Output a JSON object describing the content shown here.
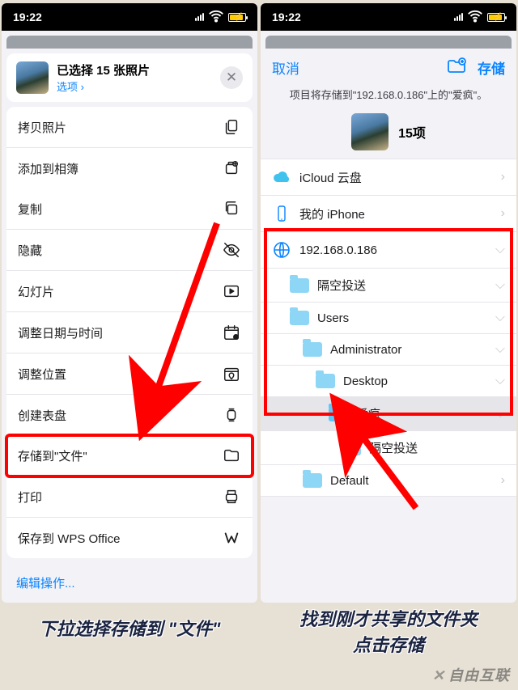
{
  "status_time": "19:22",
  "left": {
    "header_title": "已选择 15 张照片",
    "header_sub": "选项 ›",
    "rows": [
      {
        "label": "拷贝照片",
        "icon": "copy"
      },
      {
        "label": "添加到相簿",
        "icon": "album"
      },
      {
        "label": "复制",
        "icon": "dup"
      },
      {
        "label": "隐藏",
        "icon": "eye"
      },
      {
        "label": "幻灯片",
        "icon": "play"
      },
      {
        "label": "调整日期与时间",
        "icon": "cal"
      },
      {
        "label": "调整位置",
        "icon": "loc"
      },
      {
        "label": "创建表盘",
        "icon": "watch"
      },
      {
        "label": "存储到\"文件\"",
        "icon": "folder",
        "hl": true
      },
      {
        "label": "打印",
        "icon": "print"
      },
      {
        "label": "保存到 WPS Office",
        "icon": "wps"
      }
    ],
    "edit": "编辑操作..."
  },
  "right": {
    "cancel": "取消",
    "save": "存储",
    "desc": "项目将存储到\"192.168.0.186\"上的\"爱疯\"。",
    "count": "15项",
    "rows": [
      {
        "label": "iCloud 云盘",
        "icon": "cloud",
        "chev": ">"
      },
      {
        "label": "我的 iPhone",
        "icon": "iphone",
        "chev": ">"
      },
      {
        "label": "192.168.0.186",
        "icon": "globe",
        "chev": "v"
      },
      {
        "label": "隔空投送",
        "icon": "fold",
        "ind": 1,
        "chev": "v"
      },
      {
        "label": "Users",
        "icon": "fold",
        "ind": 1,
        "chev": "v"
      },
      {
        "label": "Administrator",
        "icon": "fold",
        "ind": 2,
        "chev": "v"
      },
      {
        "label": "Desktop",
        "icon": "fold",
        "ind": 3,
        "chev": "v"
      },
      {
        "label": "爱疯",
        "icon": "fold",
        "ind": 4,
        "sel": true,
        "chev": "v"
      },
      {
        "label": "隔空投送",
        "icon": "fold",
        "ind": 5
      },
      {
        "label": "Default",
        "icon": "fold",
        "ind": 2,
        "chev": ">"
      }
    ]
  },
  "caption_left": "下拉选择存储到 \"文件\"",
  "caption_right": "找到刚才共享的文件夹\n点击存储",
  "watermark": "自由互联"
}
